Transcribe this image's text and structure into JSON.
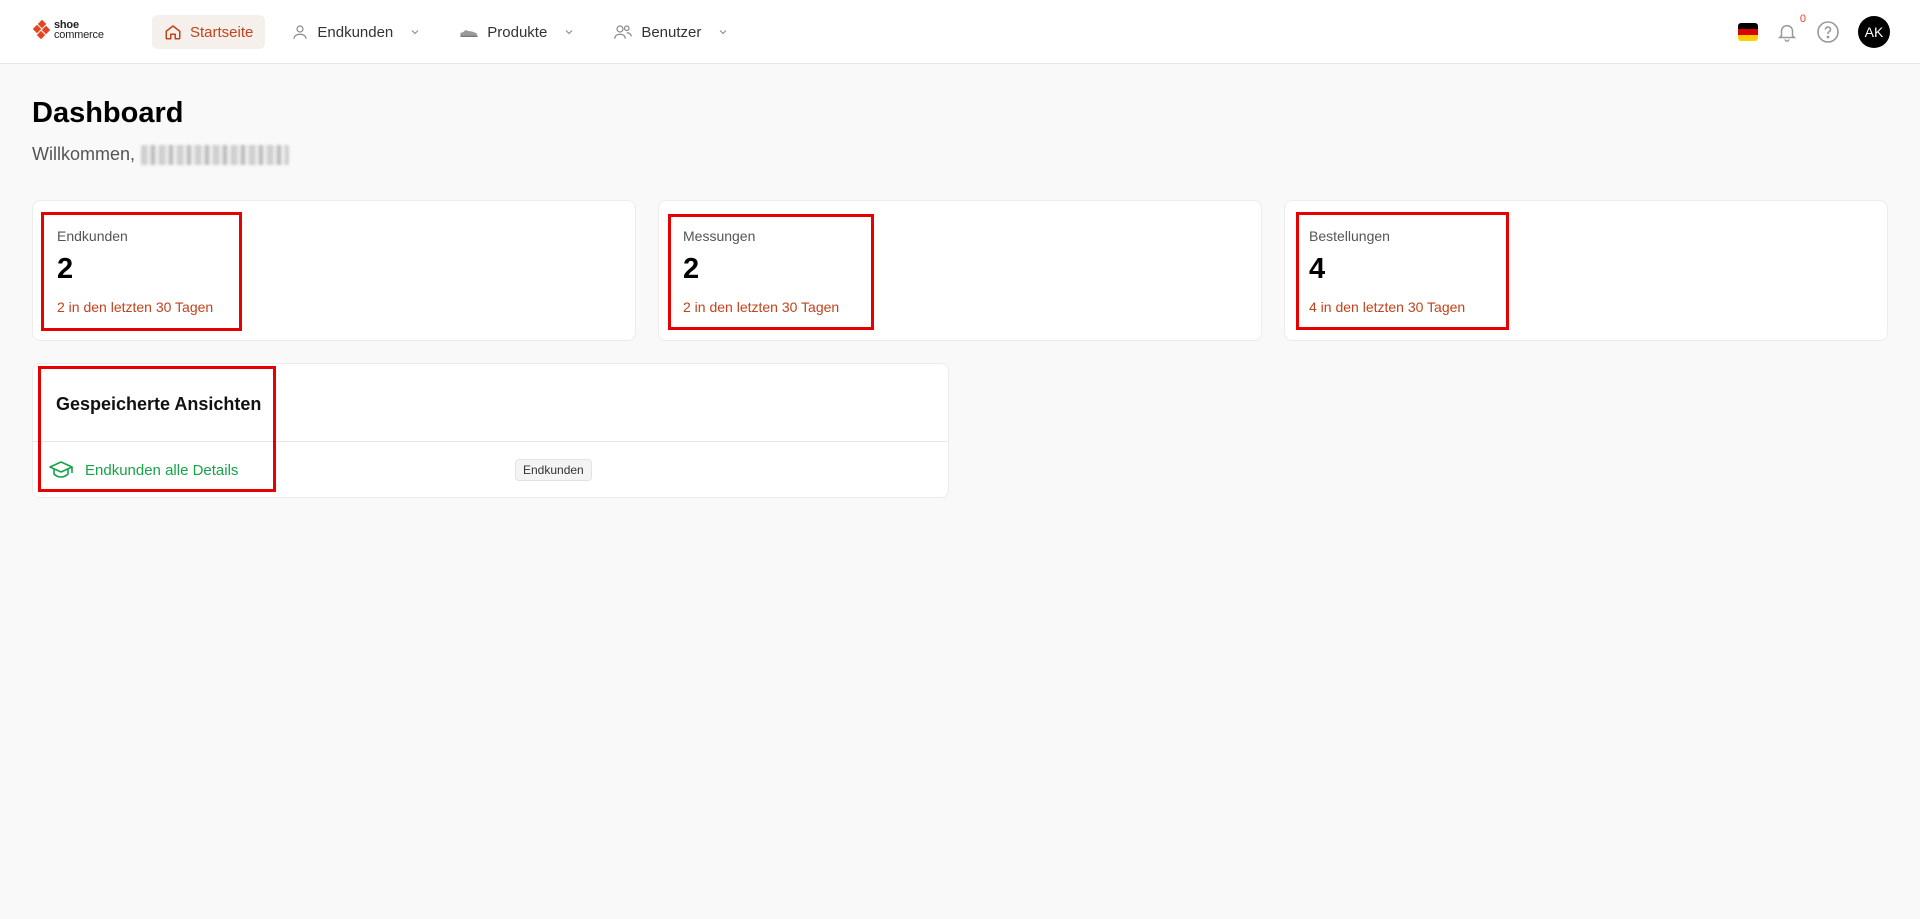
{
  "brand": {
    "line1": "shoe",
    "line2": "commerce"
  },
  "nav": {
    "items": [
      {
        "label": "Startseite",
        "icon": "home-icon",
        "active": true
      },
      {
        "label": "Endkunden",
        "icon": "user-icon",
        "dropdown": true
      },
      {
        "label": "Produkte",
        "icon": "shoe-icon",
        "dropdown": true
      },
      {
        "label": "Benutzer",
        "icon": "users-icon",
        "dropdown": true
      }
    ]
  },
  "topbar": {
    "language": "de",
    "notifications_count": "0",
    "avatar_initials": "AK"
  },
  "page": {
    "title": "Dashboard",
    "welcome": "Willkommen,"
  },
  "stats": [
    {
      "label": "Endkunden",
      "value": "2",
      "sub": "2 in den letzten 30 Tagen"
    },
    {
      "label": "Messungen",
      "value": "2",
      "sub": "2 in den letzten 30 Tagen"
    },
    {
      "label": "Bestellungen",
      "value": "4",
      "sub": "4 in den letzten 30 Tagen"
    }
  ],
  "saved_views": {
    "title": "Gespeicherte Ansichten",
    "items": [
      {
        "label": "Endkunden alle Details",
        "tag": "Endkunden",
        "icon": "graduation-cap-icon"
      }
    ]
  },
  "colors": {
    "accent": "#c3421b",
    "active_bg": "#f5f0ec",
    "success": "#16a34a",
    "highlight": "#e60000"
  }
}
